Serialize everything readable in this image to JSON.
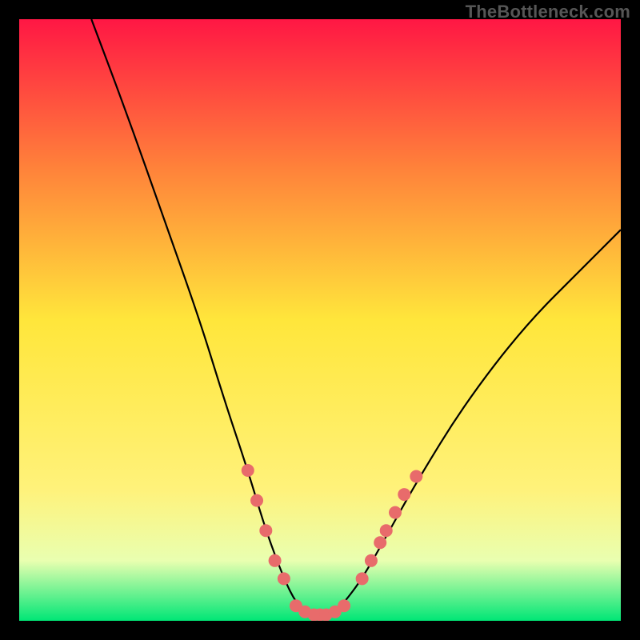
{
  "watermark": "TheBottleneck.com",
  "colors": {
    "dot_fill": "#e86b6b",
    "curve_stroke": "#000000",
    "gradient_stops": [
      {
        "offset": "0%",
        "color": "#ff1744"
      },
      {
        "offset": "25%",
        "color": "#ff833a"
      },
      {
        "offset": "50%",
        "color": "#ffe63b"
      },
      {
        "offset": "78%",
        "color": "#fff27a"
      },
      {
        "offset": "90%",
        "color": "#e9ffb0"
      },
      {
        "offset": "100%",
        "color": "#00e676"
      }
    ]
  },
  "chart_data": {
    "type": "line",
    "title": "",
    "xlabel": "",
    "ylabel": "",
    "xlim": [
      0,
      100
    ],
    "ylim": [
      0,
      100
    ],
    "grid": false,
    "series": [
      {
        "name": "bottleneck-curve",
        "x": [
          12,
          18,
          24,
          30,
          34,
          38,
          41,
          44,
          46,
          48,
          50,
          52,
          54,
          57,
          61,
          66,
          74,
          84,
          94,
          100
        ],
        "values": [
          100,
          84,
          67,
          50,
          37,
          25,
          15,
          7,
          3,
          1,
          1,
          1,
          3,
          7,
          14,
          23,
          36,
          49,
          59,
          65
        ]
      }
    ],
    "points": {
      "left_branch": [
        {
          "x": 38,
          "y": 25
        },
        {
          "x": 39.5,
          "y": 20
        },
        {
          "x": 41,
          "y": 15
        },
        {
          "x": 42.5,
          "y": 10
        },
        {
          "x": 44,
          "y": 7
        }
      ],
      "valley_floor": [
        {
          "x": 46,
          "y": 2.5
        },
        {
          "x": 47.5,
          "y": 1.5
        },
        {
          "x": 49,
          "y": 1
        },
        {
          "x": 50,
          "y": 1
        },
        {
          "x": 51,
          "y": 1
        },
        {
          "x": 52.5,
          "y": 1.5
        },
        {
          "x": 54,
          "y": 2.5
        }
      ],
      "right_branch": [
        {
          "x": 57,
          "y": 7
        },
        {
          "x": 58.5,
          "y": 10
        },
        {
          "x": 60,
          "y": 13
        },
        {
          "x": 61,
          "y": 15
        },
        {
          "x": 62.5,
          "y": 18
        },
        {
          "x": 64,
          "y": 21
        },
        {
          "x": 66,
          "y": 24
        }
      ]
    },
    "dot_radius_px": 8
  }
}
